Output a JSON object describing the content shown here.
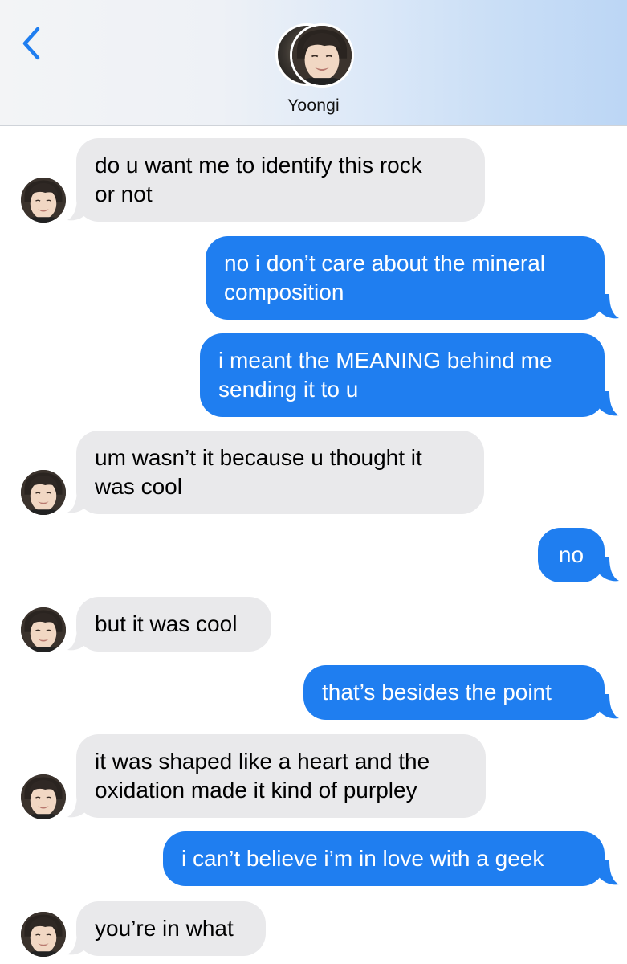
{
  "header": {
    "contact_name": "Yoongi"
  },
  "icons": {
    "back": "chevron-left-icon",
    "avatar": "contact-avatar"
  },
  "colors": {
    "incoming_bubble": "#e9e9eb",
    "outgoing_bubble": "#1f7ef0",
    "back_icon": "#1f7ef0"
  },
  "messages": [
    {
      "from": "contact",
      "text": "do u want me to identify this rock\nor not"
    },
    {
      "from": "me",
      "text": "no i don’t care about the mineral\ncomposition"
    },
    {
      "from": "me",
      "text": "i meant the MEANING behind me\nsending it to u"
    },
    {
      "from": "contact",
      "text": "um wasn’t it because u thought it\nwas cool"
    },
    {
      "from": "me",
      "text": "no"
    },
    {
      "from": "contact",
      "text": "but it was cool"
    },
    {
      "from": "me",
      "text": "that’s besides the point"
    },
    {
      "from": "contact",
      "text": "it was shaped like a heart and the\noxidation made it kind of purpley"
    },
    {
      "from": "me",
      "text": "i can’t believe i’m in love with a geek"
    },
    {
      "from": "contact",
      "text": "you’re in what"
    }
  ]
}
